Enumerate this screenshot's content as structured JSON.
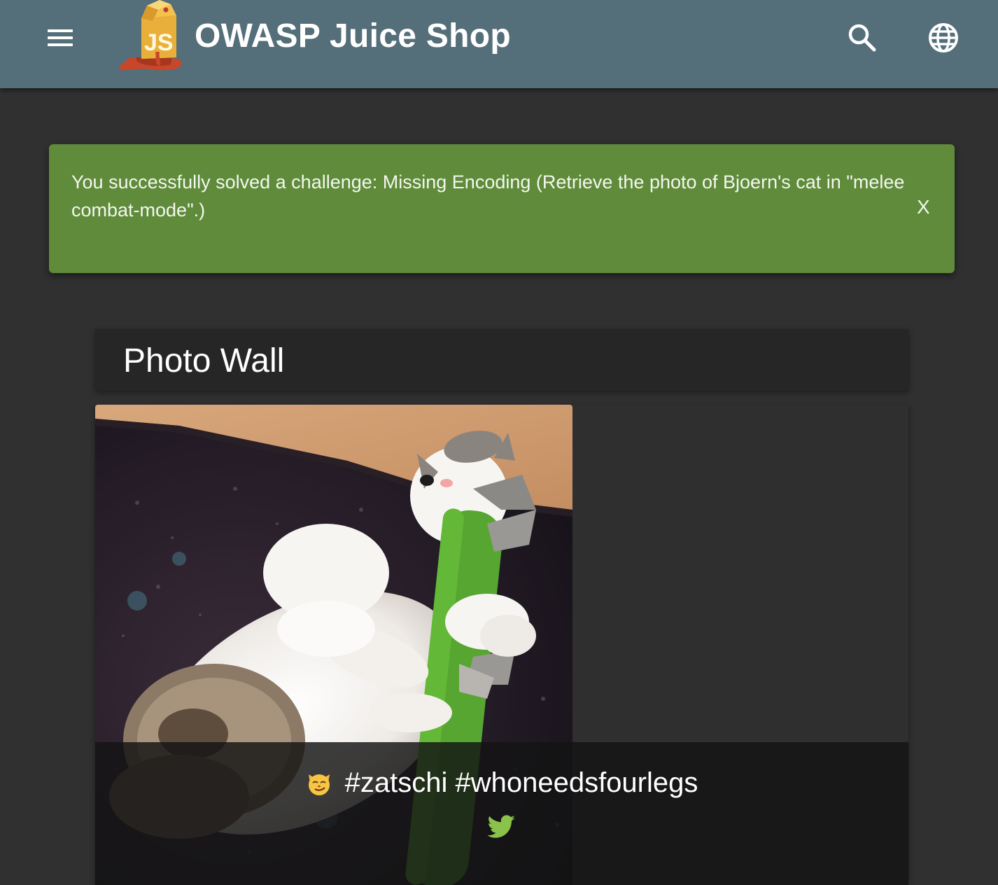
{
  "toolbar": {
    "title": "OWASP Juice Shop",
    "logo_text": "JS",
    "menu_icon": "menu-icon",
    "search_icon": "search-icon",
    "language_icon": "globe-icon"
  },
  "notification": {
    "message": "You successfully solved a challenge: Missing Encoding (Retrieve the photo of Bjoern's cat in \"melee combat-mode\".)",
    "close_label": "X",
    "color": "#5f8b3b"
  },
  "photo_wall": {
    "title": "Photo Wall",
    "posts": [
      {
        "caption": "#zatschi #whoneedsfourlegs",
        "emoji_icon": "smirking-cat-icon",
        "share_icon": "twitter-icon"
      }
    ]
  },
  "colors": {
    "toolbar": "#546e7a",
    "background": "#303030",
    "twitter": "#8bc34a"
  }
}
